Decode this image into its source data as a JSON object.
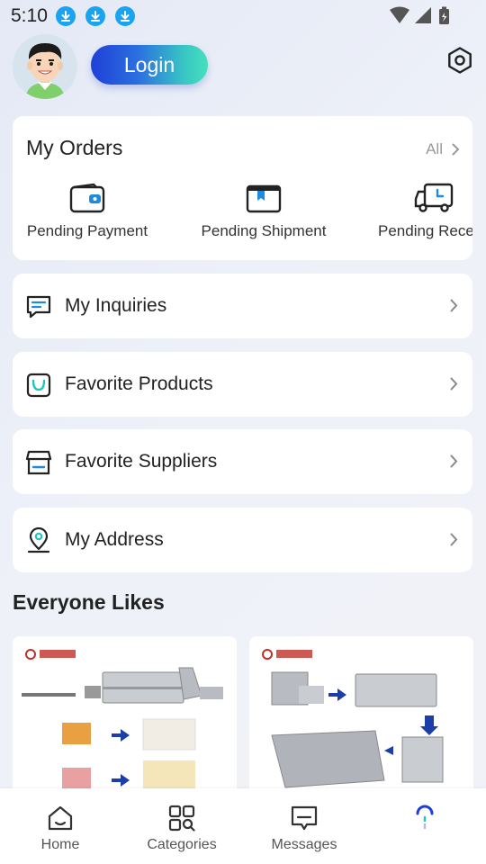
{
  "status_bar": {
    "time": "5:10"
  },
  "header": {
    "login_label": "Login"
  },
  "orders": {
    "title": "My Orders",
    "all_label": "All",
    "items": [
      {
        "label": "Pending Payment",
        "icon": "wallet-icon"
      },
      {
        "label": "Pending Shipment",
        "icon": "box-icon"
      },
      {
        "label": "Pending Receipt",
        "icon": "truck-icon"
      }
    ]
  },
  "menu": [
    {
      "label": "My Inquiries",
      "icon": "message-icon"
    },
    {
      "label": "Favorite Products",
      "icon": "shopping-bag-icon"
    },
    {
      "label": "Favorite Suppliers",
      "icon": "store-icon"
    },
    {
      "label": "My Address",
      "icon": "location-pin-icon"
    }
  ],
  "recommend": {
    "title": "Everyone Likes"
  },
  "bottom_nav": [
    {
      "label": "Home",
      "icon": "home-icon"
    },
    {
      "label": "Categories",
      "icon": "categories-icon"
    },
    {
      "label": "Messages",
      "icon": "messages-icon"
    },
    {
      "label": "",
      "icon": "loading-spinner-icon"
    }
  ],
  "colors": {
    "accent_blue": "#1e40d6",
    "accent_teal": "#45e0bd",
    "download_badge": "#1aa3f0"
  }
}
